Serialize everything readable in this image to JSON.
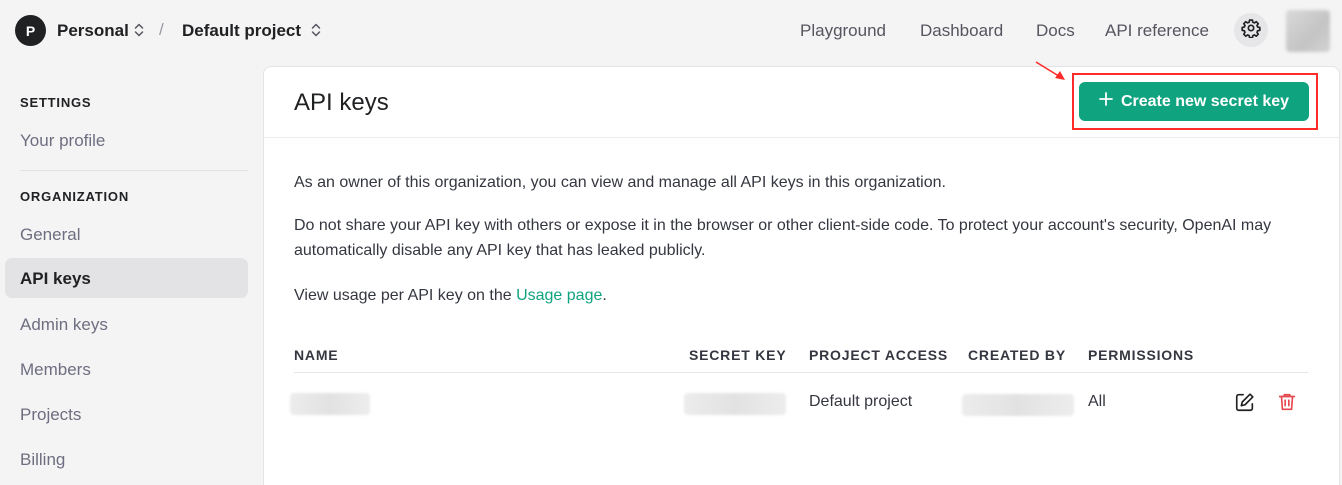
{
  "topbar": {
    "org_initial": "P",
    "org_name": "Personal",
    "separator": "/",
    "project_name": "Default project",
    "nav": [
      "Playground",
      "Dashboard",
      "Docs",
      "API reference"
    ]
  },
  "sidebar": {
    "settings_heading": "SETTINGS",
    "your_profile": "Your profile",
    "org_heading": "ORGANIZATION",
    "items": [
      "General",
      "API keys",
      "Admin keys",
      "Members",
      "Projects",
      "Billing"
    ],
    "active_item": "API keys"
  },
  "main": {
    "title": "API keys",
    "create_button": "Create new secret key",
    "para1": "As an owner of this organization, you can view and manage all API keys in this organization.",
    "para2": "Do not share your API key with others or expose it in the browser or other client-side code. To protect your account's security, OpenAI may automatically disable any API key that has leaked publicly.",
    "para3_prefix": "View usage per API key on the ",
    "para3_link": "Usage page",
    "para3_suffix": ".",
    "table": {
      "headers": [
        "NAME",
        "SECRET KEY",
        "PROJECT ACCESS",
        "CREATED BY",
        "PERMISSIONS"
      ],
      "rows": [
        {
          "project_access": "Default project",
          "permissions": "All"
        }
      ]
    }
  },
  "colors": {
    "accent": "#10a37f",
    "highlight": "#ff2b2b",
    "delete": "#e5484d"
  },
  "icons": [
    "chevron-updown-icon",
    "gear-icon",
    "plus-icon",
    "edit-icon",
    "trash-icon",
    "arrow-annotation-icon"
  ]
}
